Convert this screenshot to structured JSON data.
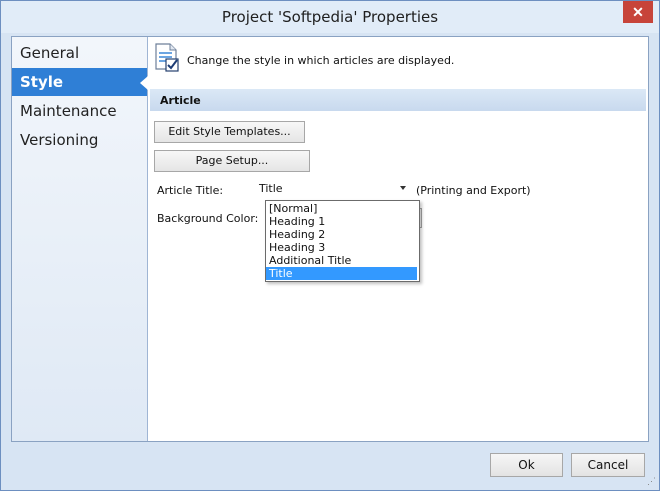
{
  "window": {
    "title": "Project 'Softpedia' Properties",
    "close_glyph": "✕"
  },
  "sidebar": {
    "items": [
      {
        "label": "General"
      },
      {
        "label": "Style"
      },
      {
        "label": "Maintenance"
      },
      {
        "label": "Versioning"
      }
    ],
    "active": "Style"
  },
  "main": {
    "description": "Change the style in which articles are displayed.",
    "section_title": "Article",
    "edit_templates_label": "Edit Style Templates...",
    "page_setup_label": "Page Setup...",
    "article_title_label": "Article Title:",
    "article_title_value": "Title",
    "article_title_note": "(Printing and Export)",
    "background_color_label": "Background Color:",
    "dropdown_options": [
      "[Normal]",
      "Heading 1",
      "Heading 2",
      "Heading 3",
      "Additional Title",
      "Title"
    ],
    "selected_option": "Title"
  },
  "footer": {
    "ok_label": "Ok",
    "cancel_label": "Cancel"
  },
  "colors": {
    "accent": "#2f7fd6",
    "selection": "#3399ff",
    "close": "#c7443a"
  }
}
